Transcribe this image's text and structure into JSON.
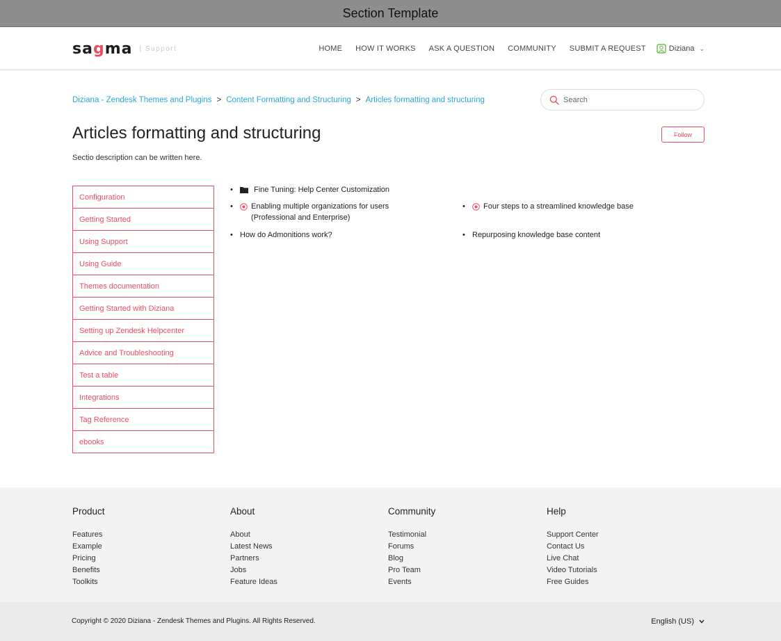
{
  "window": {
    "title": "Section Template"
  },
  "header": {
    "logo": {
      "text_left": "sa",
      "text_mid": "g",
      "text_right": "ma",
      "sub": "| Support"
    },
    "nav": [
      "HOME",
      "HOW IT WORKS",
      "ASK A QUESTION",
      "COMMUNITY",
      "SUBMIT A REQUEST"
    ],
    "user": {
      "name": "Diziana",
      "icon": "user-avatar-icon"
    }
  },
  "breadcrumb": [
    "Diziana - Zendesk Themes and Plugins",
    "Content Formatting and Structuring",
    "Articles formatting and structuring"
  ],
  "search": {
    "placeholder": "Search"
  },
  "section": {
    "title": "Articles formatting and structuring",
    "follow_label": "Follow",
    "description": "Sectio description can be written here."
  },
  "sidebar": [
    "Configuration",
    "Getting Started",
    "Using Support",
    "Using Guide",
    "Themes documentation",
    "Getting Started with Diziana",
    "Setting up Zendesk Helpcenter",
    "Advice and Troubleshooting",
    "Test a table",
    "Integrations",
    "Tag Reference",
    "ebooks"
  ],
  "articles": {
    "subsection": "Fine Tuning: Help Center Customization",
    "items": [
      {
        "title": "Enabling multiple organizations for users (Professional and Enterprise)",
        "promoted": true
      },
      {
        "title": "Four steps to a streamlined knowledge base",
        "promoted": true
      },
      {
        "title": "How do Admonitions work?",
        "promoted": false
      },
      {
        "title": "Repurposing knowledge base content",
        "promoted": false
      }
    ]
  },
  "footer": {
    "columns": [
      {
        "heading": "Product",
        "links": [
          "Features",
          "Example",
          "Pricing",
          "Benefits",
          "Toolkits"
        ]
      },
      {
        "heading": "About",
        "links": [
          "About",
          "Latest News",
          "Partners",
          "Jobs",
          "Feature Ideas"
        ]
      },
      {
        "heading": "Community",
        "links": [
          "Testimonial",
          "Forums",
          "Blog",
          "Pro Team",
          "Events"
        ]
      },
      {
        "heading": "Help",
        "links": [
          "Support Center",
          "Contact Us",
          "Live Chat",
          "Video Tutorials",
          "Free Guides"
        ]
      }
    ],
    "copyright": "Copyright © 2020 Diziana - Zendesk Themes and Plugins. All Rights Reserved.",
    "language": "English (US)"
  },
  "colors": {
    "accent": "#ee4d5f",
    "link": "#29a8d8",
    "footer_bg": "#f3f3f3",
    "user_icon": "#6cc04a"
  }
}
